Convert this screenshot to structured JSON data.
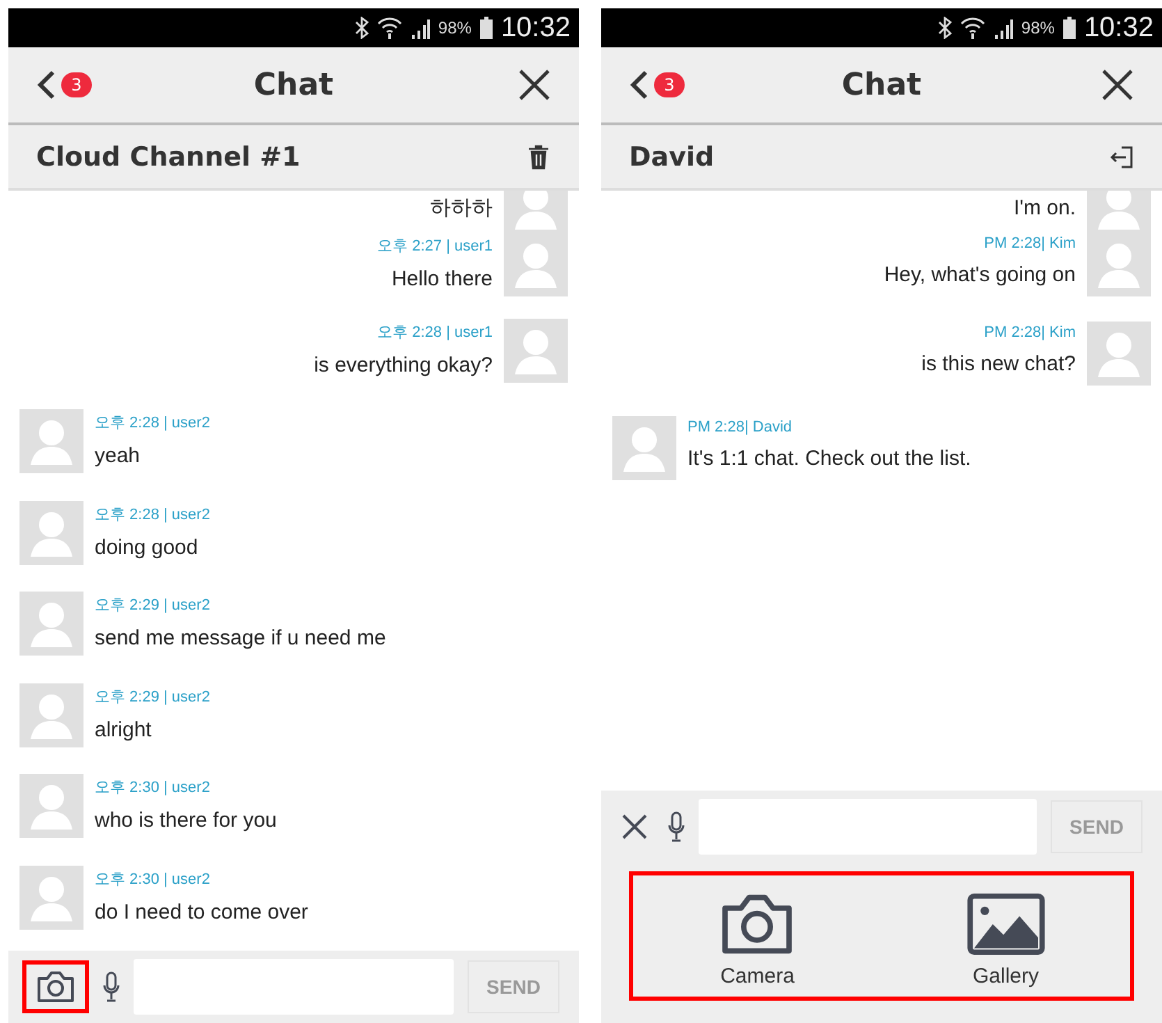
{
  "screens": [
    {
      "status_bar": {
        "battery": "98%",
        "time": "10:32"
      },
      "header": {
        "badge": "3",
        "title": "Chat"
      },
      "channel": {
        "name": "Cloud Channel #1",
        "kind": "delete"
      },
      "messages": [
        {
          "kind": "sent",
          "text": "하하하"
        },
        {
          "kind": "sent",
          "meta": "오후 2:27 | user1",
          "text": "Hello there"
        },
        {
          "kind": "sent",
          "meta": "오후 2:28 | user1",
          "text": "is everything okay?"
        },
        {
          "kind": "received",
          "meta": "오후 2:28 | user2",
          "text": "yeah"
        },
        {
          "kind": "received",
          "meta": "오후 2:28 | user2",
          "text": "doing good"
        },
        {
          "kind": "received",
          "meta": "오후 2:29 | user2",
          "text": "send me message if u need me"
        },
        {
          "kind": "received",
          "meta": "오후 2:29 | user2",
          "text": "alright"
        },
        {
          "kind": "received",
          "meta": "오후 2:30 | user2",
          "text": "who is there for you"
        },
        {
          "kind": "received",
          "meta": "오후 2:30 | user2",
          "text": "do I need to come over"
        }
      ],
      "composer": {
        "expanded": false,
        "camera_button": {
          "highlighted": true
        },
        "send": "SEND"
      }
    },
    {
      "status_bar": {
        "battery": "98%",
        "time": "10:32"
      },
      "header": {
        "badge": "3",
        "title": "Chat"
      },
      "channel": {
        "name": "David",
        "kind": "leave"
      },
      "messages": [
        {
          "kind": "sent",
          "text": "I'm on."
        },
        {
          "kind": "sent",
          "meta": "PM 2:28| Kim",
          "text": "Hey, what's going on"
        },
        {
          "kind": "sent",
          "meta": "PM 2:28| Kim",
          "text": "is this new chat?"
        },
        {
          "kind": "received",
          "meta": "PM 2:28| David",
          "text": "It's 1:1 chat. Check out the list."
        }
      ],
      "composer": {
        "expanded": true,
        "send": "SEND",
        "attach_panel": {
          "highlighted": true,
          "options": [
            {
              "kind": "camera",
              "label": "Camera"
            },
            {
              "kind": "gallery",
              "label": "Gallery"
            }
          ]
        }
      }
    }
  ]
}
